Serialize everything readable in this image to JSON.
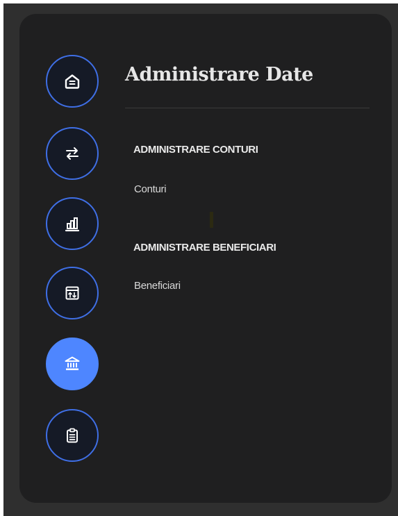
{
  "colors": {
    "backdrop": "#2f2f2f",
    "panel": "#1f1f20",
    "accent": "#4e86ff",
    "nav_border": "#3f6fe6",
    "text": "#e6e6e6"
  },
  "nav": {
    "items": [
      {
        "name": "home",
        "icon": "home-icon",
        "active": false
      },
      {
        "name": "transfers",
        "icon": "arrows-exchange-icon",
        "active": false
      },
      {
        "name": "reports",
        "icon": "bar-chart-icon",
        "active": false
      },
      {
        "name": "transactions",
        "icon": "calendar-transfer-icon",
        "active": false
      },
      {
        "name": "administration",
        "icon": "bank-icon",
        "active": true
      },
      {
        "name": "requests",
        "icon": "clipboard-icon",
        "active": false
      }
    ]
  },
  "content": {
    "title": "Administrare Date",
    "sections": [
      {
        "heading": "ADMINISTRARE CONTURI",
        "links": [
          "Conturi"
        ]
      },
      {
        "heading": "ADMINISTRARE BENEFICIARI",
        "links": [
          "Beneficiari"
        ]
      }
    ]
  }
}
